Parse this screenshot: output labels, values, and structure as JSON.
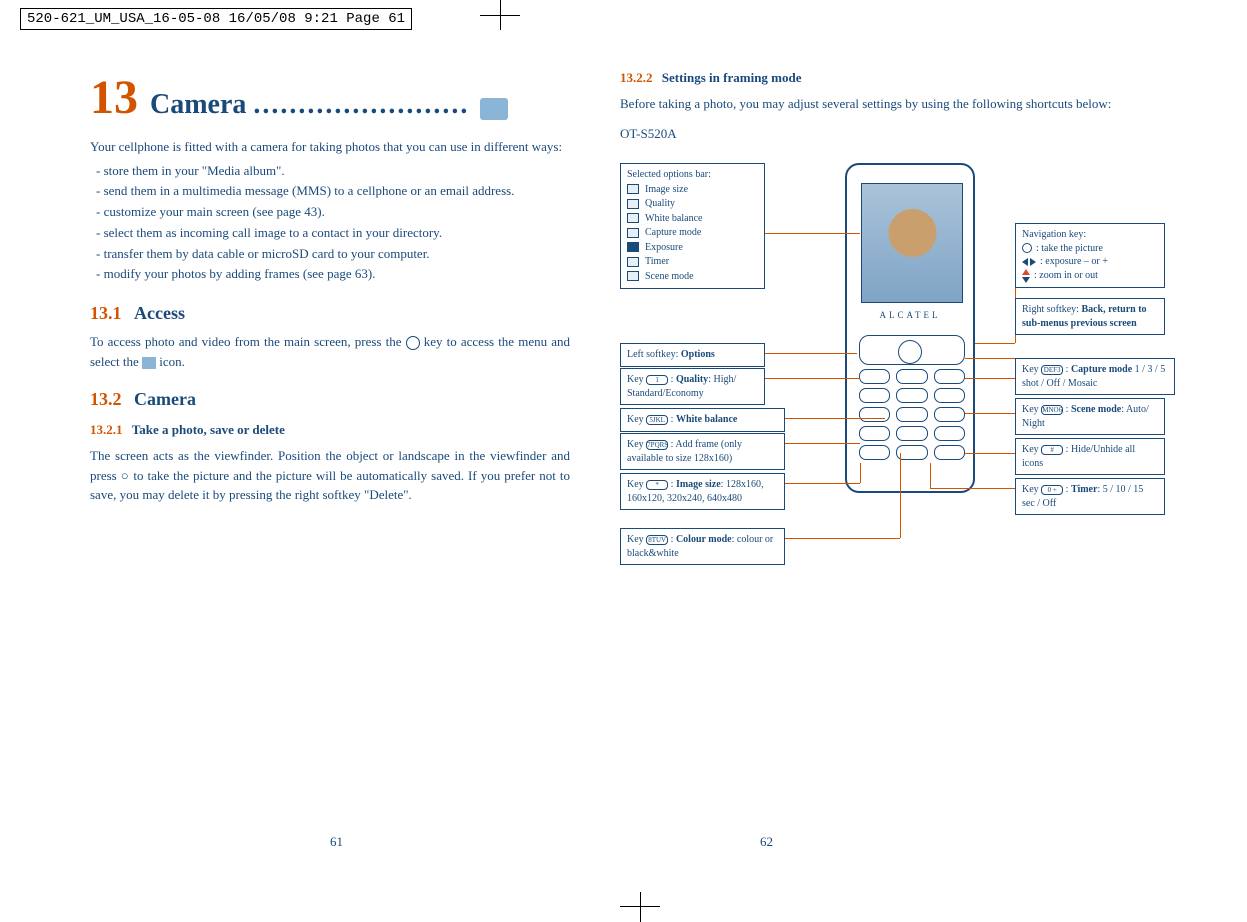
{
  "print_header": "520-621_UM_USA_16-05-08  16/05/08  9:21  Page 61",
  "chapter": {
    "num": "13",
    "title": "Camera",
    "dots": "........................"
  },
  "intro": "Your cellphone is fitted with a camera for taking photos that you can use in different ways:",
  "bullets": [
    "store them in your \"Media album\".",
    "send them in a multimedia message (MMS) to a cellphone or an email address.",
    "customize your main screen (see page 43).",
    "select them as incoming call image to a contact in your directory.",
    "transfer them by data cable or microSD card to your computer.",
    "modify your photos by adding frames (see page 63)."
  ],
  "s13_1": {
    "num": "13.1",
    "title": "Access",
    "body_a": "To access photo and video from the main screen, press the ",
    "body_b": " key to access the menu and select the ",
    "body_c": " icon."
  },
  "s13_2": {
    "num": "13.2",
    "title": "Camera",
    "sub_num": "13.2.1",
    "sub_title": "Take a photo, save or delete",
    "body": "The screen acts as the viewfinder. Position the object or landscape in the viewfinder and press  ○  to take the picture and the picture will be automatically saved. If you prefer not to save, you may delete it by pressing the right softkey \"Delete\"."
  },
  "s13_2_2": {
    "num": "13.2.2",
    "title": "Settings in framing mode",
    "body": "Before taking a photo, you may adjust several settings by using the following shortcuts below:",
    "model": "OT-S520A"
  },
  "phone_brand": "ALCATEL",
  "callouts": {
    "options_bar": {
      "title": "Selected options bar:",
      "items": [
        "Image size",
        "Quality",
        "White balance",
        "Capture mode",
        "Exposure",
        "Timer",
        "Scene mode"
      ]
    },
    "left_softkey": {
      "pre": "Left softkey: ",
      "bold": "Options"
    },
    "key1": {
      "pre": "Key ",
      "k": "1",
      "mid": " : ",
      "bold": "Quality",
      "post": ": High/ Standard/Economy"
    },
    "key5": {
      "pre": "Key ",
      "k": "5JKL",
      "mid": " : ",
      "bold": "White balance"
    },
    "key7": {
      "pre": "Key ",
      "k": "7PQRS",
      "mid": " : Add frame (only available to size 128x160)"
    },
    "keystar": {
      "pre": "Key ",
      "k": "*",
      "mid": " : ",
      "bold": "Image size",
      "post": ": 128x160, 160x120, 320x240, 640x480"
    },
    "key8": {
      "pre": "Key ",
      "k": "8TUV",
      "mid": " : ",
      "bold": "Colour mode",
      "post": ": colour or black&white"
    },
    "navkey": {
      "title": "Navigation key:",
      "l1": ": take the picture",
      "l2": ": exposure – or +",
      "l3": ": zoom in or out"
    },
    "right_softkey": {
      "pre": "Right softkey: ",
      "bold": "Back, return to sub-menus previous screen"
    },
    "key3": {
      "pre": "Key ",
      "k": "DEF3",
      "mid": " : ",
      "bold": "Capture mode",
      "post": " 1 / 3 / 5 shot / Off / Mosaic"
    },
    "key6": {
      "pre": "Key ",
      "k": "MNO6",
      "mid": " : ",
      "bold": "Scene mode",
      "post": ": Auto/ Night"
    },
    "keyhash": {
      "pre": "Key ",
      "k": "#",
      "mid": " : Hide/Unhide all icons"
    },
    "key0": {
      "pre": "Key ",
      "k": "0 +",
      "mid": " : ",
      "bold": "Timer",
      "post": ": 5 / 10 / 15 sec / Off"
    }
  },
  "page_left": "61",
  "page_right": "62"
}
